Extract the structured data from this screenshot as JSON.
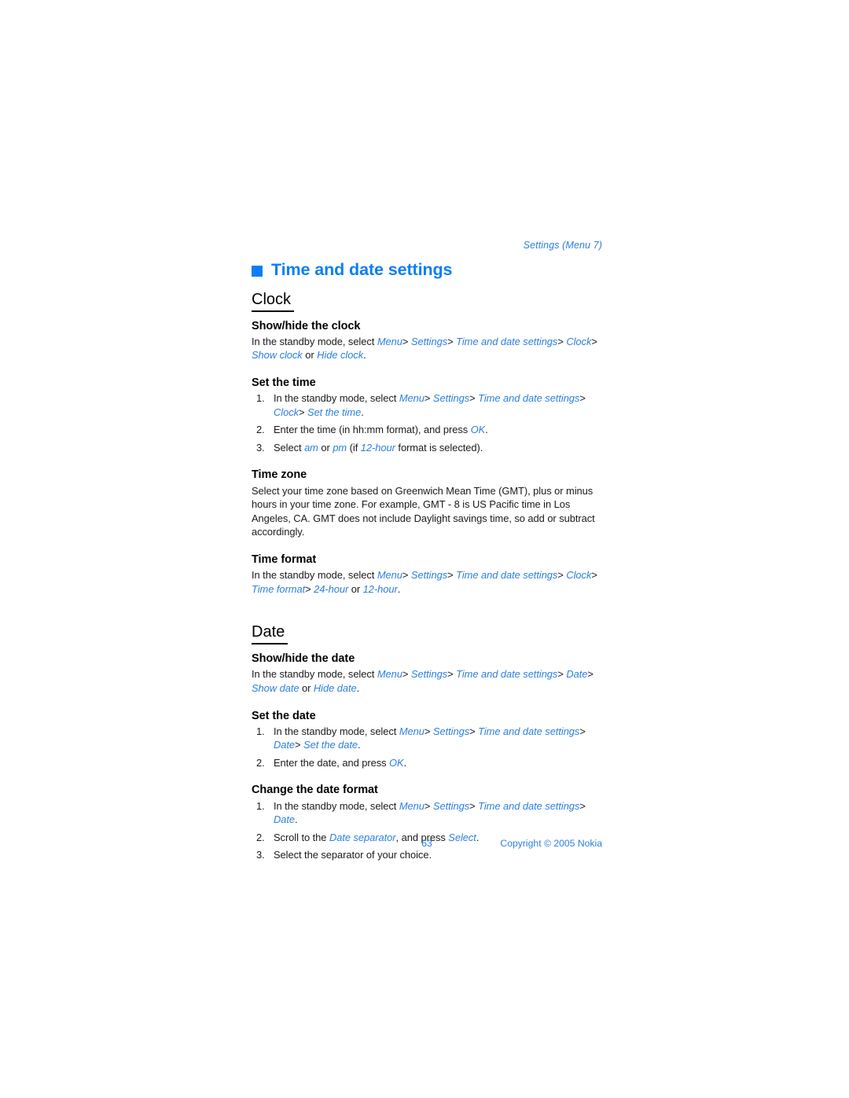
{
  "document": {
    "running_header": "Settings (Menu 7)",
    "chapter_title": "Time and date settings",
    "accent_color": "#0b7ef5",
    "link_color": "#2b7fe0"
  },
  "sections": {
    "clock": {
      "heading": "Clock",
      "show_hide": {
        "heading": "Show/hide the clock",
        "line1_lead": "In the standby mode, select ",
        "terms": {
          "menu": "Menu",
          "settings": "Settings",
          "time_and_date_settings": "Time and date settings",
          "clock": "Clock",
          "show_clock": "Show clock",
          "hide_clock": "Hide clock"
        },
        "or": " or ",
        "period": "."
      },
      "set_the_time": {
        "heading": "Set the time",
        "step1_lead": "In the standby mode, select ",
        "step1_terms": {
          "menu": "Menu",
          "settings": "Settings",
          "time_and_date_settings": "Time and date settings",
          "clock": "Clock",
          "set_the_time": "Set the time"
        },
        "step2_a": "Enter the time (in hh:mm format), and press ",
        "step2_ok": "OK",
        "step2_b": ".",
        "step3_a": "Select ",
        "step3_am": "am",
        "step3_or": " or ",
        "step3_pm": "pm",
        "step3_b": " (if ",
        "step3_12hour": "12-hour",
        "step3_c": " format is selected)."
      },
      "time_zone": {
        "heading": "Time zone",
        "body": "Select your time zone based on Greenwich Mean Time (GMT), plus or minus hours in your time zone. For example, GMT - 8 is US Pacific time in Los Angeles, CA. GMT does not include Daylight savings time, so add or subtract accordingly."
      },
      "time_format": {
        "heading": "Time format",
        "lead": "In the standby mode, select ",
        "terms": {
          "menu": "Menu",
          "settings": "Settings",
          "time_and_date_settings": "Time and date settings",
          "clock": "Clock",
          "time_format": "Time format",
          "h24": "24-hour",
          "h12": "12-hour"
        },
        "or": " or ",
        "period": "."
      }
    },
    "date": {
      "heading": "Date",
      "show_hide": {
        "heading": "Show/hide the date",
        "lead": "In the standby mode, select ",
        "terms": {
          "menu": "Menu",
          "settings": "Settings",
          "time_and_date_settings": "Time and date settings",
          "date": "Date",
          "show_date": "Show date",
          "hide_date": "Hide date"
        },
        "or": " or ",
        "period": "."
      },
      "set_the_date": {
        "heading": "Set the date",
        "step1_lead": "In the standby mode, select ",
        "step1_terms": {
          "menu": "Menu",
          "settings": "Settings",
          "time_and_date_settings": "Time and date settings",
          "date": "Date",
          "set_the_date": "Set the date"
        },
        "step2_a": "Enter the date, and press ",
        "step2_ok": "OK",
        "step2_b": "."
      },
      "change_format": {
        "heading": "Change the date format",
        "step1_lead": "In the standby mode, select ",
        "step1_terms": {
          "menu": "Menu",
          "settings": "Settings",
          "time_and_date_settings": "Time and date settings",
          "date": "Date"
        },
        "step1_period": ".",
        "step2_a": "Scroll to the ",
        "step2_term": "Date separator",
        "step2_b": ", and press ",
        "step2_select": "Select",
        "step2_c": ".",
        "step3": "Select the separator of your choice."
      }
    }
  },
  "markers": {
    "n1": "1.",
    "n2": "2.",
    "n3": "3.",
    "gt": ">"
  },
  "footer": {
    "page_number": "63",
    "copyright": "Copyright © 2005 Nokia"
  }
}
